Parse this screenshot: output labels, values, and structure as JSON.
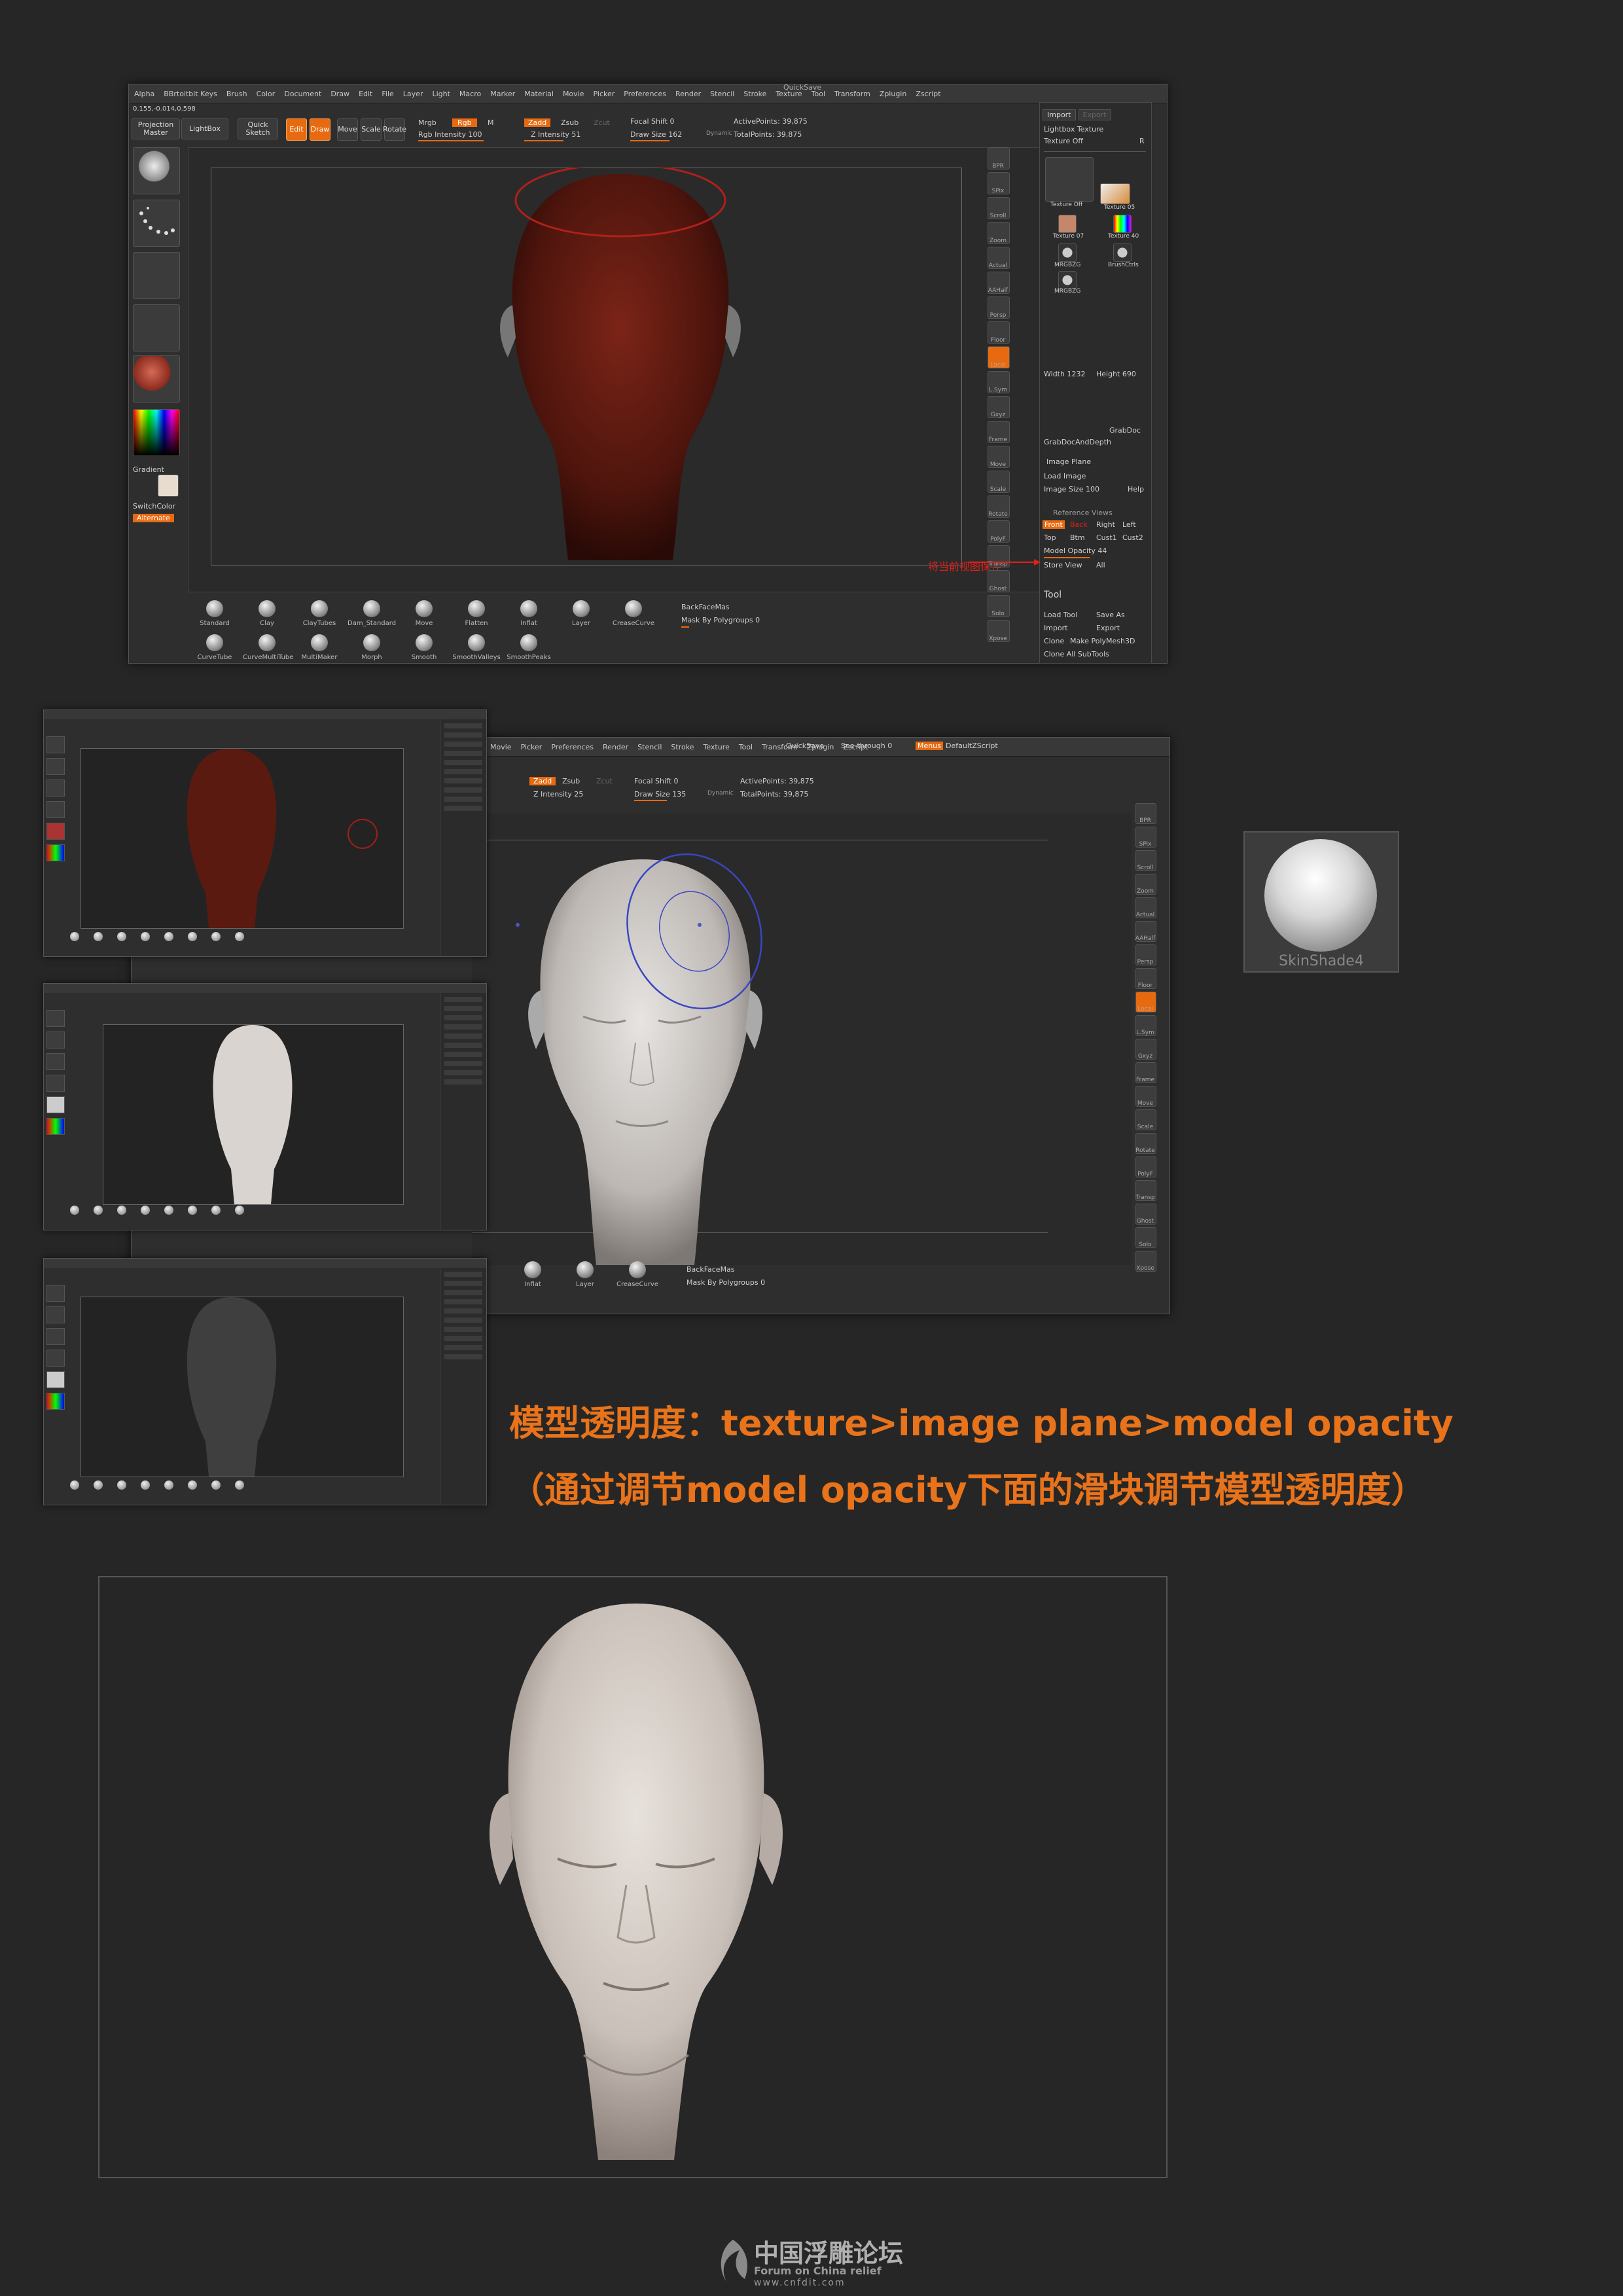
{
  "colors": {
    "accent": "#e86a10",
    "caption": "#e8731a",
    "background": "#262626"
  },
  "top_window": {
    "title_right": "QuickSave",
    "menu": [
      "Alpha",
      "BBrtoitbit Keys",
      "Brush",
      "Color",
      "Document",
      "Draw",
      "Edit",
      "File",
      "Layer",
      "Light",
      "Macro",
      "Marker",
      "Material",
      "Movie",
      "Picker",
      "Preferences",
      "Render",
      "Stencil",
      "Stroke",
      "Texture",
      "Tool",
      "Transform",
      "Zplugin",
      "Zscript"
    ],
    "coords": "0.155,-0.014,0.598",
    "toolbar": {
      "projection_master": "Projection Master",
      "lightbox": "LightBox",
      "quick_sketch": "Quick Sketch",
      "edit": "Edit",
      "draw": "Draw",
      "move": "Move",
      "scale": "Scale",
      "rotate": "Rotate",
      "mrgb": "Mrgb",
      "rgb": "Rgb",
      "m": "M",
      "rgb_intensity": "Rgb Intensity 100",
      "zadd": "Zadd",
      "zsub": "Zsub",
      "zcut": "Zcut",
      "z_intensity": "Z Intensity 51",
      "focal_shift": "Focal Shift 0",
      "draw_size": "Draw Size 162",
      "dynamic": "Dynamic",
      "active_points": "ActivePoints: 39,875",
      "total_points": "TotalPoints: 39,875"
    },
    "left_shelf": [
      "Gradient",
      "SwitchColor",
      "Alternate"
    ],
    "right_shelf": [
      "BPR",
      "SPix",
      "Scroll",
      "Zoom",
      "Actual",
      "AAHalf",
      "Persp",
      "Floor",
      "Local",
      "L.Sym",
      "Gxyz",
      "Frame",
      "Move",
      "Scale",
      "Rotate",
      "PolyF",
      "Transp",
      "Ghost",
      "Solo",
      "Xpose"
    ],
    "tpanel": {
      "import": "Import",
      "export": "Export",
      "lightbox_texture": "Lightbox Texture",
      "texture_off": "Texture Off",
      "texture_off_r": "R",
      "tex_labels": [
        "Texture Off",
        "Texture 05",
        "Texture 07",
        "Texture 40",
        "MRGBZG",
        "BrushCtrls",
        "MRGBZG"
      ],
      "width": "Width 1232",
      "height": "Height 690",
      "grab_doc": "GrabDoc",
      "grab_doc_depth": "GrabDocAndDepth",
      "image_plane": "Image Plane",
      "load_image": "Load Image",
      "image_size": "Image Size 100",
      "help": "Help",
      "reference_views": "Reference Views",
      "front": "Front",
      "back": "Back",
      "right": "Right",
      "left": "Left",
      "top": "Top",
      "btm": "Btm",
      "cust1": "Cust1",
      "cust2": "Cust2",
      "model_opacity": "Model Opacity 44",
      "store_view": "Store View",
      "all": "All",
      "tool": "Tool",
      "load_tool": "Load Tool",
      "save_as": "Save As",
      "import2": "Import",
      "export2": "Export",
      "clone": "Clone",
      "make_polymesh": "Make PolyMesh3D",
      "clone_all": "Clone All SubTools"
    },
    "annotation_cn": "将当前视图保存",
    "brushes_row1": [
      "Standard",
      "Clay",
      "ClayTubes",
      "Dam_Standard",
      "Move",
      "Flatten",
      "Inflat",
      "Layer",
      "CreaseCurve"
    ],
    "brushes_row2": [
      "CurveTube",
      "CurveMultiTube",
      "MultiMaker",
      "Morph",
      "Smooth",
      "SmoothValleys",
      "SmoothPeaks"
    ],
    "backface": "BackFaceMas",
    "mask_by_polygroups": "Mask By Polygroups 0"
  },
  "mid_window": {
    "quicksave": "QuickSave",
    "see_through": "See-through 0",
    "menus": "Menus",
    "default_zscript": "DefaultZScript",
    "menu": [
      "Movie",
      "Picker",
      "Preferences",
      "Render",
      "Stencil",
      "Stroke",
      "Texture",
      "Tool",
      "Transform",
      "Zplugin",
      "Zscript"
    ],
    "zadd": "Zadd",
    "zsub": "Zsub",
    "zcut": "Zcut",
    "z_intensity": "Z Intensity 25",
    "focal_shift": "Focal Shift 0",
    "draw_size": "Draw Size 135",
    "dynamic": "Dynamic",
    "active_points": "ActivePoints: 39,875",
    "total_points": "TotalPoints: 39,875",
    "bottom_brushes": [
      "Inflat",
      "Layer",
      "CreaseCurve"
    ],
    "backface": "BackFaceMas",
    "mask_by_polygroups": "Mask By Polygroups 0"
  },
  "material": {
    "name": "SkinShade4"
  },
  "caption": {
    "line1": "模型透明度：texture>image plane>model opacity",
    "line2": "（通过调节model opacity下面的滑块调节模型透明度）"
  },
  "logo": {
    "cn": "中国浮雕论坛",
    "en": "Forum on China relief",
    "url": "www.cnfdit.com"
  }
}
